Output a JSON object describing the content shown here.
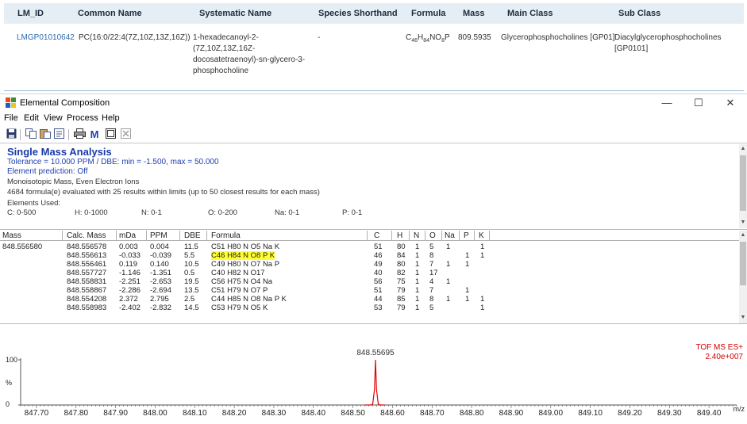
{
  "lm_table": {
    "headers": [
      "LM_ID",
      "Common Name",
      "Systematic Name",
      "Species Shorthand",
      "Formula",
      "Mass",
      "Main Class",
      "Sub Class"
    ],
    "row": {
      "lm_id": "LMGP01010642",
      "common_name": "PC(16:0/22:4(7Z,10Z,13Z,16Z))",
      "systematic_name_lines": [
        "1-hexadecanoyl-2-",
        "(7Z,10Z,13Z,16Z-",
        "docosatetraenoyl)-sn-glycero-3-",
        "phosphocholine"
      ],
      "species_shorthand": "-",
      "formula": "C46H84NO8P",
      "formula_parts": [
        "C",
        "46",
        "H",
        "84",
        "NO",
        "8",
        "P"
      ],
      "mass": "809.5935",
      "main_class": "Glycerophosphocholines [GP01]",
      "sub_class_lines": [
        "Diacylglycerophosphocholines",
        "[GP0101]"
      ]
    }
  },
  "window": {
    "title": "Elemental Composition",
    "controls": {
      "minimize": "—",
      "maximize": "☐",
      "close": "✕"
    },
    "menu": [
      "File",
      "Edit",
      "View",
      "Process",
      "Help"
    ],
    "toolbar": [
      "save-icon",
      "copy-icon",
      "paste-icon",
      "properties-icon",
      "print-icon",
      "m-icon",
      "window-icon",
      "close-doc-icon"
    ]
  },
  "info": {
    "heading": "Single Mass Analysis",
    "tolerance": "Tolerance = 10.000 PPM   /   DBE: min = -1.500, max = 50.000",
    "element_prediction": "Element prediction: Off",
    "mass_mode": "Monoisotopic Mass, Even Electron Ions",
    "evaluated": "4684 formula(e) evaluated with 25 results within limits (up to 50 closest results for each mass)",
    "elements_used_label": "Elements Used:",
    "elements": [
      "C: 0-500",
      "H: 0-1000",
      "N: 0-1",
      "O: 0-200",
      "Na: 0-1",
      "P: 0-1"
    ]
  },
  "results": {
    "headers": [
      "Mass",
      "Calc. Mass",
      "mDa",
      "PPM",
      "DBE",
      "Formula",
      "C",
      "H",
      "N",
      "O",
      "Na",
      "P",
      "K"
    ],
    "mass": "848.556580",
    "rows": [
      {
        "calc": "848.556578",
        "mda": "0.003",
        "ppm": "0.004",
        "dbe": "11.5",
        "formula": "C51 H80 N O5 Na K",
        "c": "51",
        "h": "80",
        "n": "1",
        "o": "5",
        "na": "1",
        "p": "",
        "k": "1",
        "highlight": false
      },
      {
        "calc": "848.556613",
        "mda": "-0.033",
        "ppm": "-0.039",
        "dbe": "5.5",
        "formula": "C46 H84 N O8 P K",
        "c": "46",
        "h": "84",
        "n": "1",
        "o": "8",
        "na": "",
        "p": "1",
        "k": "1",
        "highlight": true
      },
      {
        "calc": "848.556461",
        "mda": "0.119",
        "ppm": "0.140",
        "dbe": "10.5",
        "formula": "C49 H80 N O7 Na P",
        "c": "49",
        "h": "80",
        "n": "1",
        "o": "7",
        "na": "1",
        "p": "1",
        "k": "",
        "highlight": false
      },
      {
        "calc": "848.557727",
        "mda": "-1.146",
        "ppm": "-1.351",
        "dbe": "0.5",
        "formula": "C40 H82 N O17",
        "c": "40",
        "h": "82",
        "n": "1",
        "o": "17",
        "na": "",
        "p": "",
        "k": "",
        "highlight": false
      },
      {
        "calc": "848.558831",
        "mda": "-2.251",
        "ppm": "-2.653",
        "dbe": "19.5",
        "formula": "C56 H75 N O4 Na",
        "c": "56",
        "h": "75",
        "n": "1",
        "o": "4",
        "na": "1",
        "p": "",
        "k": "",
        "highlight": false
      },
      {
        "calc": "848.558867",
        "mda": "-2.286",
        "ppm": "-2.694",
        "dbe": "13.5",
        "formula": "C51 H79 N O7 P",
        "c": "51",
        "h": "79",
        "n": "1",
        "o": "7",
        "na": "",
        "p": "1",
        "k": "",
        "highlight": false
      },
      {
        "calc": "848.554208",
        "mda": "2.372",
        "ppm": "2.795",
        "dbe": "2.5",
        "formula": "C44 H85 N O8 Na P K",
        "c": "44",
        "h": "85",
        "n": "1",
        "o": "8",
        "na": "1",
        "p": "1",
        "k": "1",
        "highlight": false
      },
      {
        "calc": "848.558983",
        "mda": "-2.402",
        "ppm": "-2.832",
        "dbe": "14.5",
        "formula": "C53 H79 N O5 K",
        "c": "53",
        "h": "79",
        "n": "1",
        "o": "5",
        "na": "",
        "p": "",
        "k": "1",
        "highlight": false
      }
    ]
  },
  "chart_data": {
    "type": "line",
    "title": "",
    "annotation": "TOF MS ES+",
    "intensity": "2.40e+007",
    "peak_label": "848.55695",
    "peak_x": 848.55695,
    "xlabel": "m/z",
    "ylabel": "%",
    "ylim": [
      0,
      100
    ],
    "y_ticks": [
      "100",
      "%",
      "0"
    ],
    "xlim": [
      847.66,
      849.47
    ],
    "x_ticks": [
      "847.70",
      "847.80",
      "847.90",
      "848.00",
      "848.10",
      "848.20",
      "848.30",
      "848.40",
      "848.50",
      "848.60",
      "848.70",
      "848.80",
      "848.90",
      "849.00",
      "849.10",
      "849.20",
      "849.30",
      "849.40"
    ],
    "series": [
      {
        "x": [
          848.53,
          848.545,
          848.55,
          848.5545,
          848.557,
          848.5595,
          848.564,
          848.569,
          848.58
        ],
        "y": [
          0,
          0,
          2,
          35,
          100,
          35,
          2,
          0,
          0
        ]
      }
    ]
  },
  "colors": {
    "peak": "#e60000",
    "annotation": "#d40000",
    "highlight": "#ffff33",
    "heading": "#1a3aa8",
    "link": "#2a6bb0"
  }
}
